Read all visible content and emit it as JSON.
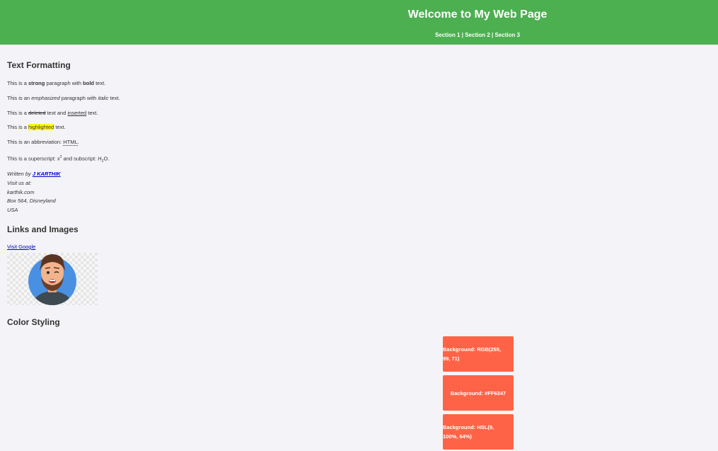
{
  "header": {
    "title": "Welcome to My Web Page",
    "nav": [
      "Section 1",
      "Section 2",
      "Section 3"
    ],
    "separator": " | "
  },
  "text_formatting": {
    "heading": "Text Formatting",
    "strong_line": {
      "a": "This is a ",
      "strong": "strong",
      "b": " paragraph with ",
      "bold": "bold",
      "c": " text."
    },
    "em_line": {
      "a": "This is an ",
      "em": "emphasized",
      "b": " paragraph with ",
      "italic": "italic",
      "c": " text."
    },
    "del_line": {
      "a": "This is a ",
      "deleted": "deleted",
      "b": " text and ",
      "inserted": "inserted",
      "c": " text."
    },
    "mark_line": {
      "a": "This is a ",
      "highlighted": "highlighted",
      "b": " text."
    },
    "abbr_line": {
      "a": "This is an abbreviation: ",
      "abbr": "HTML",
      "b": "."
    },
    "sup_line": {
      "a": "This is a superscript: x",
      "sup": "2",
      "b": " and subscript: H",
      "sub": "2",
      "c": "O."
    },
    "address": {
      "written_by": "Written by ",
      "author": "J KARTHIK",
      "visit": "Visit us at:",
      "site": "karthik.com",
      "box": "Box 564, Disneyland",
      "country": "USA"
    }
  },
  "links_images": {
    "heading": "Links and Images",
    "link_text": "Visit Google",
    "image_icon": "avatar-man-winking-icon"
  },
  "color_styling": {
    "heading": "Color Styling",
    "boxes": [
      {
        "line1": "Background: RGB(255,",
        "line2": "99, 71)"
      },
      {
        "line1": "Background: #FF6347",
        "line2": ""
      },
      {
        "line1": "Background: HSL(9,",
        "line2": "100%, 64%)"
      }
    ],
    "box_color": "#FF6347"
  },
  "colors": {
    "header_bg": "#4CAF50",
    "page_bg": "#F4F4F8",
    "link": "#0000CC",
    "highlight": "#FFFF00"
  }
}
